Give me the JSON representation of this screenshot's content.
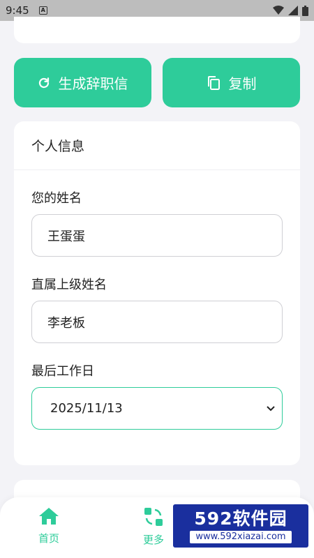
{
  "status_bar": {
    "time": "9:45",
    "indicator": "A"
  },
  "actions": {
    "generate_label": "生成辞职信",
    "copy_label": "复制"
  },
  "info_card": {
    "title": "个人信息",
    "name_label": "您的姓名",
    "name_value": "王蛋蛋",
    "boss_label": "直属上级姓名",
    "boss_value": "李老板",
    "lastday_label": "最后工作日",
    "lastday_value": "2025/11/13"
  },
  "bottom_nav": {
    "home_label": "首页",
    "more_label": "更多"
  },
  "watermark": {
    "brand": "592软件园",
    "url": "www.592xiazai.com"
  },
  "colors": {
    "accent": "#2ecc9a",
    "background": "#f3f3f7",
    "watermark": "#1a2f9e"
  }
}
